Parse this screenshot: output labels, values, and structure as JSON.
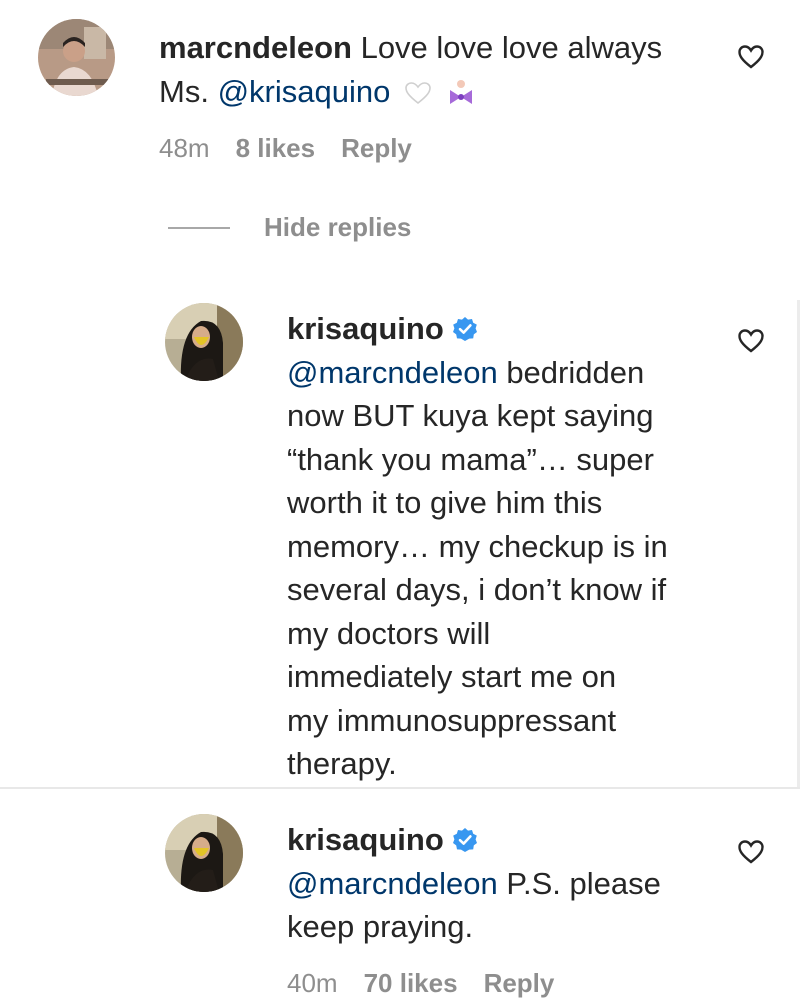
{
  "comment": {
    "username": "marcndeleon",
    "text_line1": "Love love love always",
    "prefix": "Ms.",
    "mention": "@krisaquino",
    "time": "48m",
    "likes": "8 likes",
    "reply_label": "Reply"
  },
  "hide_replies_label": "Hide replies",
  "replies": [
    {
      "username": "krisaquino",
      "mention": "@marcndeleon",
      "line1": " bedridden",
      "lines": [
        "now BUT kuya kept saying",
        "“thank you mama”… super",
        "worth it to give him this",
        "memory… my checkup is in",
        "several days, i don’t know if",
        "my doctors will",
        "immediately start me on",
        "my immunosuppressant",
        "therapy."
      ]
    },
    {
      "username": "krisaquino",
      "mention": "@marcndeleon",
      "line1": " P.S. please",
      "line2": "keep praying.",
      "time": "40m",
      "likes": "70 likes",
      "reply_label": "Reply"
    }
  ],
  "colors": {
    "text": "#262626",
    "secondary": "#8e8e8e",
    "mention": "#00376b",
    "verified": "#3897f0"
  }
}
